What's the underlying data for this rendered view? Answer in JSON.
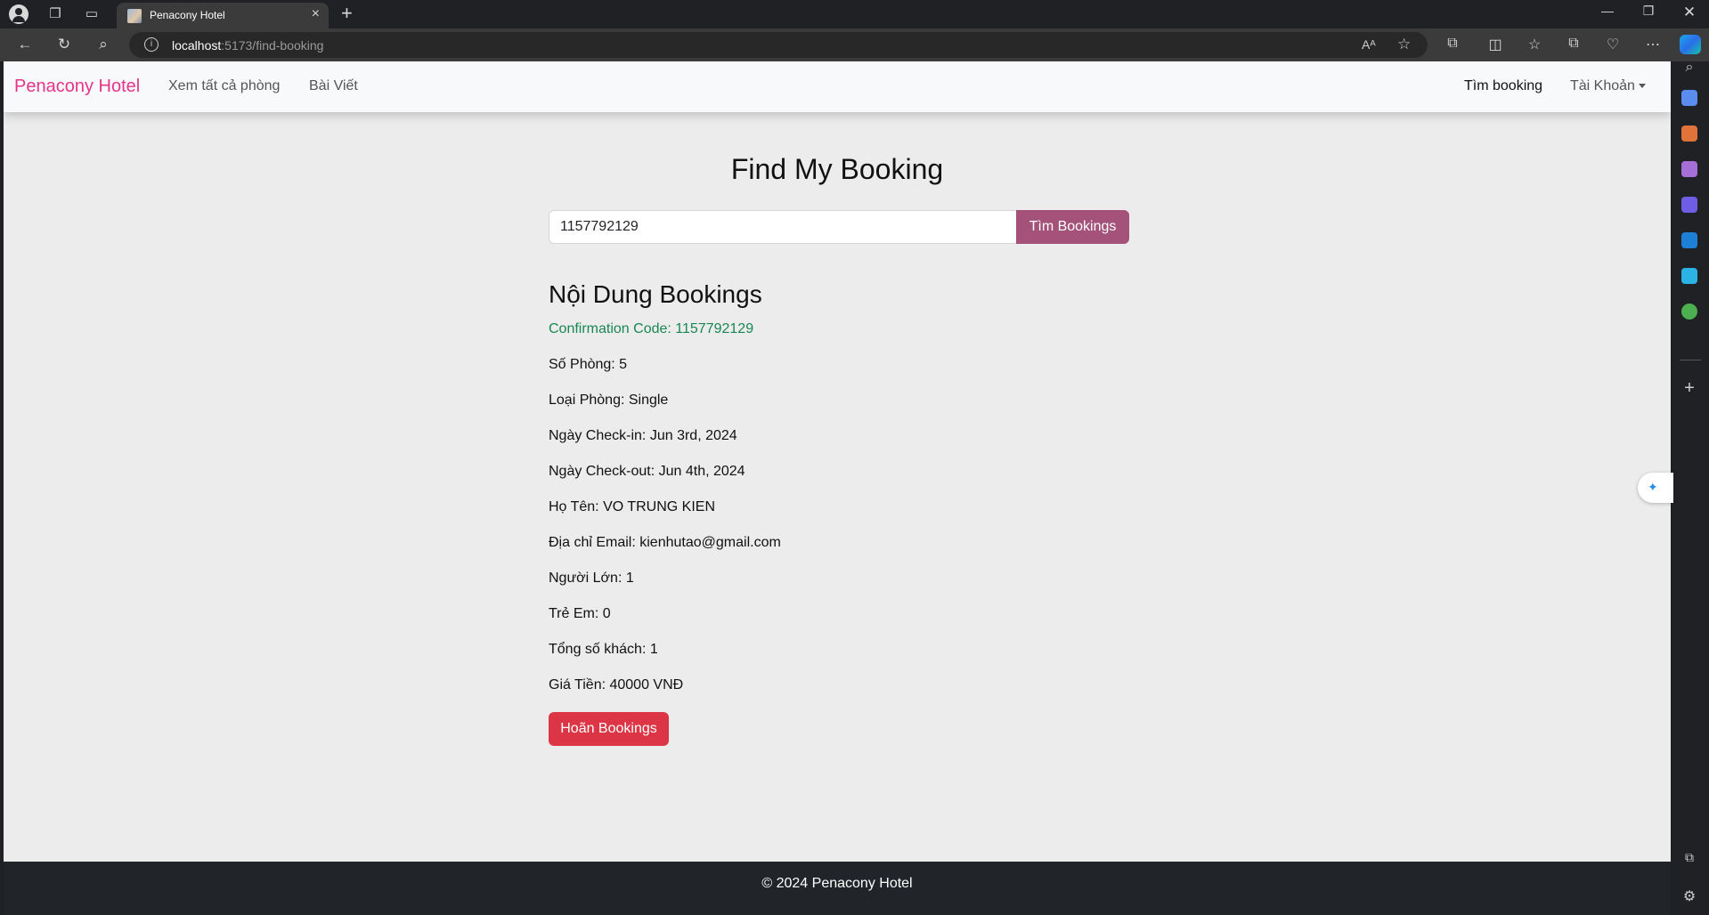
{
  "browser": {
    "tab_title": "Penacony Hotel",
    "url_host": "localhost",
    "url_path": ":5173/find-booking",
    "read_aloud": "Aᴬ"
  },
  "navbar": {
    "brand": "Penacony Hotel",
    "links": [
      "Xem tất cả phòng",
      "Bài Viết"
    ],
    "find_booking": "Tìm booking",
    "account": "Tài Khoản"
  },
  "page": {
    "title": "Find My Booking",
    "search_value": "1157792129",
    "search_button": "Tìm Bookings"
  },
  "details": {
    "heading": "Nội Dung Bookings",
    "rows": [
      "Confirmation Code: 1157792129",
      "Số Phòng: 5",
      "Loại Phòng: Single",
      "Ngày Check-in: Jun 3rd, 2024",
      "Ngày Check-out: Jun 4th, 2024",
      "Họ Tên: VO TRUNG KIEN",
      "Địa chỉ Email: kienhutao@gmail.com",
      "Người Lớn: 1",
      "Trẻ Em: 0",
      "Tổng số khách: 1",
      "Giá Tiền: 40000 VNĐ"
    ],
    "cancel_button": "Hoãn Bookings"
  },
  "footer": {
    "text": "© 2024 Penacony Hotel"
  },
  "colors": {
    "brand": "#e6338b",
    "search_button": "#a4527a",
    "cancel_button": "#dc3545",
    "confirmation": "#198754",
    "footer": "#212529"
  }
}
